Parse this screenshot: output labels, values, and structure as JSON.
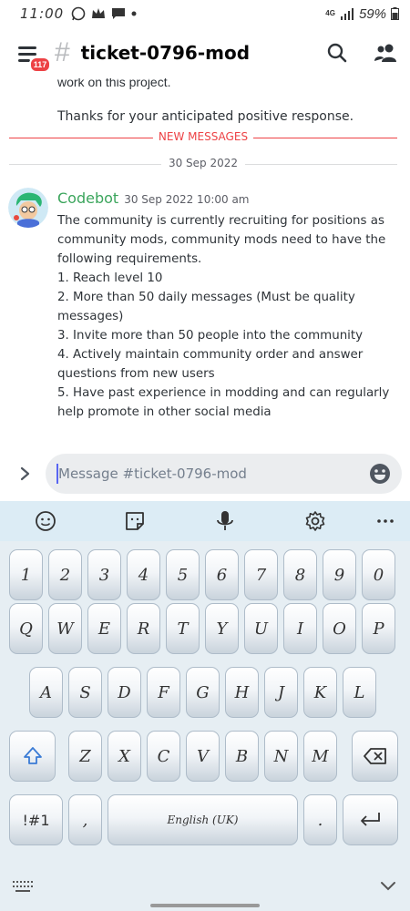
{
  "status_bar": {
    "time": "11:00",
    "network": "4G",
    "battery": "59%",
    "icons": [
      "whatsapp-icon",
      "crown-icon",
      "chat-icon",
      "dot-icon"
    ]
  },
  "header": {
    "badge_count": "117",
    "channel_name": "ticket-0796-mod"
  },
  "messages": {
    "cut_text": "work on this project.",
    "previous_message": "Thanks for your anticipated positive response.",
    "new_messages_label": "NEW MESSAGES",
    "date_label": "30 Sep 2022",
    "author": "Codebot",
    "timestamp": "30 Sep 2022 10:00 am",
    "lines": [
      "The community is currently recruiting for positions as community mods, community mods need to have the following requirements.",
      "1. Reach level 10",
      "2. More than 50 daily messages (Must be quality messages)",
      "3. Invite more than 50 people into the community",
      "4. Actively maintain community order and answer questions from new users",
      "5. Have past experience in modding and can regularly help promote in other social media"
    ]
  },
  "composer": {
    "placeholder": "Message #ticket-0796-mod"
  },
  "keyboard": {
    "toolbar_icons": [
      "emoji-icon",
      "sticker-icon",
      "microphone-icon",
      "settings-icon",
      "more-icon"
    ],
    "row_numbers": [
      "1",
      "2",
      "3",
      "4",
      "5",
      "6",
      "7",
      "8",
      "9",
      "0"
    ],
    "row_q": [
      "Q",
      "W",
      "E",
      "R",
      "T",
      "Y",
      "U",
      "I",
      "O",
      "P"
    ],
    "row_a": [
      "A",
      "S",
      "D",
      "F",
      "G",
      "H",
      "J",
      "K",
      "L"
    ],
    "row_z": [
      "Z",
      "X",
      "C",
      "V",
      "B",
      "N",
      "M"
    ],
    "sym_key": "!#1",
    "comma_key": ",",
    "space_key": "English (UK)",
    "period_key": "."
  },
  "colors": {
    "new_messages": "#ed4245",
    "author": "#3ba55c",
    "accent": "#5865f2"
  }
}
